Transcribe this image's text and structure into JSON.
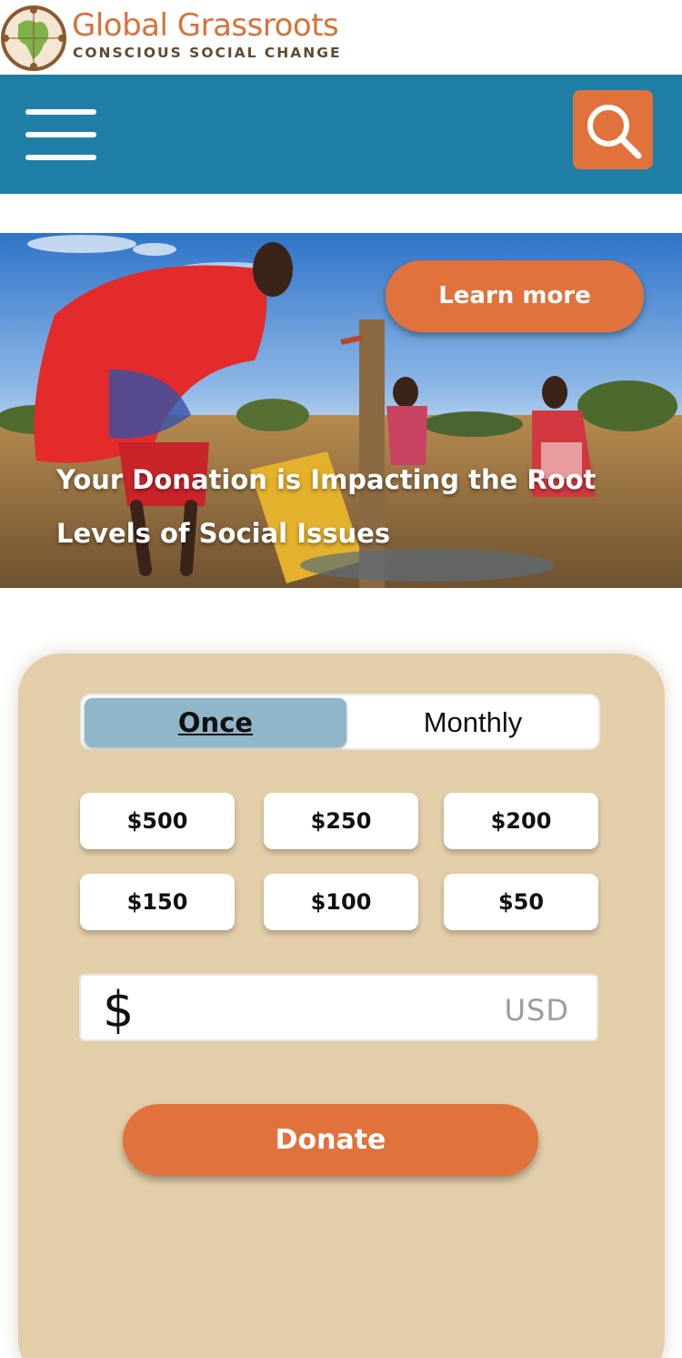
{
  "brand": {
    "name": "Global Grassroots",
    "tagline": "CONSCIOUS SOCIAL CHANGE"
  },
  "colors": {
    "brand_orange": "#e1723c",
    "nav_blue": "#1f7fa6",
    "card_beige": "#e2cea8",
    "selected_toggle": "#8fb7c9"
  },
  "nav": {
    "menu_icon": "hamburger-menu-icon",
    "search_icon": "search-icon"
  },
  "hero": {
    "cta_label": "Learn more",
    "headline": "Your Donation is Impacting the Root Levels of Social Issues"
  },
  "donation": {
    "frequency": {
      "options": [
        "Once",
        "Monthly"
      ],
      "selected": "Once"
    },
    "amounts": [
      "$500",
      "$250",
      "$200",
      "$150",
      "$100",
      "$50"
    ],
    "custom": {
      "symbol": "$",
      "value": "",
      "currency": "USD"
    },
    "submit_label": "Donate"
  }
}
